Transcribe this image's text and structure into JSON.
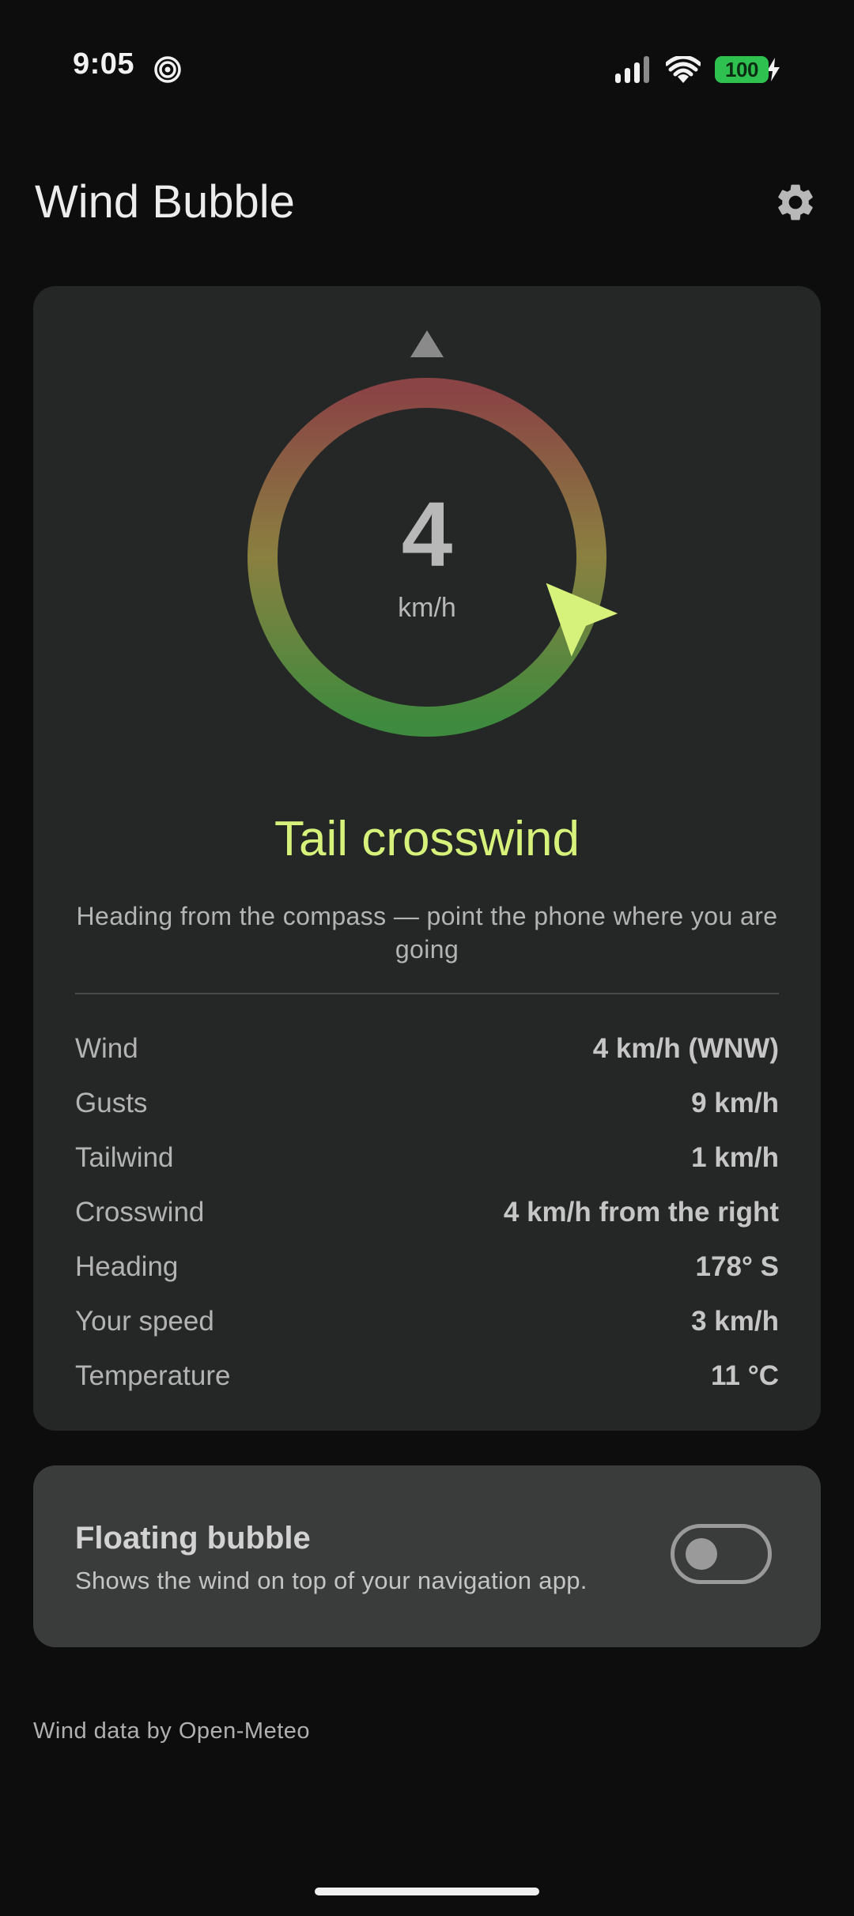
{
  "status_bar": {
    "time": "9:05",
    "battery_level": "100",
    "icons": [
      "hotspot-icon",
      "signal-icon",
      "wifi-icon",
      "charging-icon"
    ]
  },
  "app": {
    "title": "Wind Bubble",
    "settings_icon": "gear-icon"
  },
  "wind_display": {
    "speed": "4",
    "unit": "km/h",
    "status": "Tail crosswind",
    "hint": "Heading from the compass — point the phone where you are going",
    "wind_arrow_angle_deg": 112,
    "colors": {
      "status": "#d6f27a",
      "arrow": "#d6f27a",
      "ring_head": "#8a4445",
      "ring_side": "#8a8040",
      "ring_tail": "#3e8a3e"
    }
  },
  "stats": [
    {
      "label": "Wind",
      "value": "4 km/h (WNW)"
    },
    {
      "label": "Gusts",
      "value": "9 km/h"
    },
    {
      "label": "Tailwind",
      "value": "1 km/h"
    },
    {
      "label": "Crosswind",
      "value": "4 km/h from the right"
    },
    {
      "label": "Heading",
      "value": "178° S"
    },
    {
      "label": "Your speed",
      "value": "3 km/h"
    },
    {
      "label": "Temperature",
      "value": "11 °C"
    }
  ],
  "floating_bubble": {
    "title": "Floating bubble",
    "description": "Shows the wind on top of your navigation app.",
    "enabled": false
  },
  "footer": {
    "credit": "Wind data by Open-Meteo"
  }
}
